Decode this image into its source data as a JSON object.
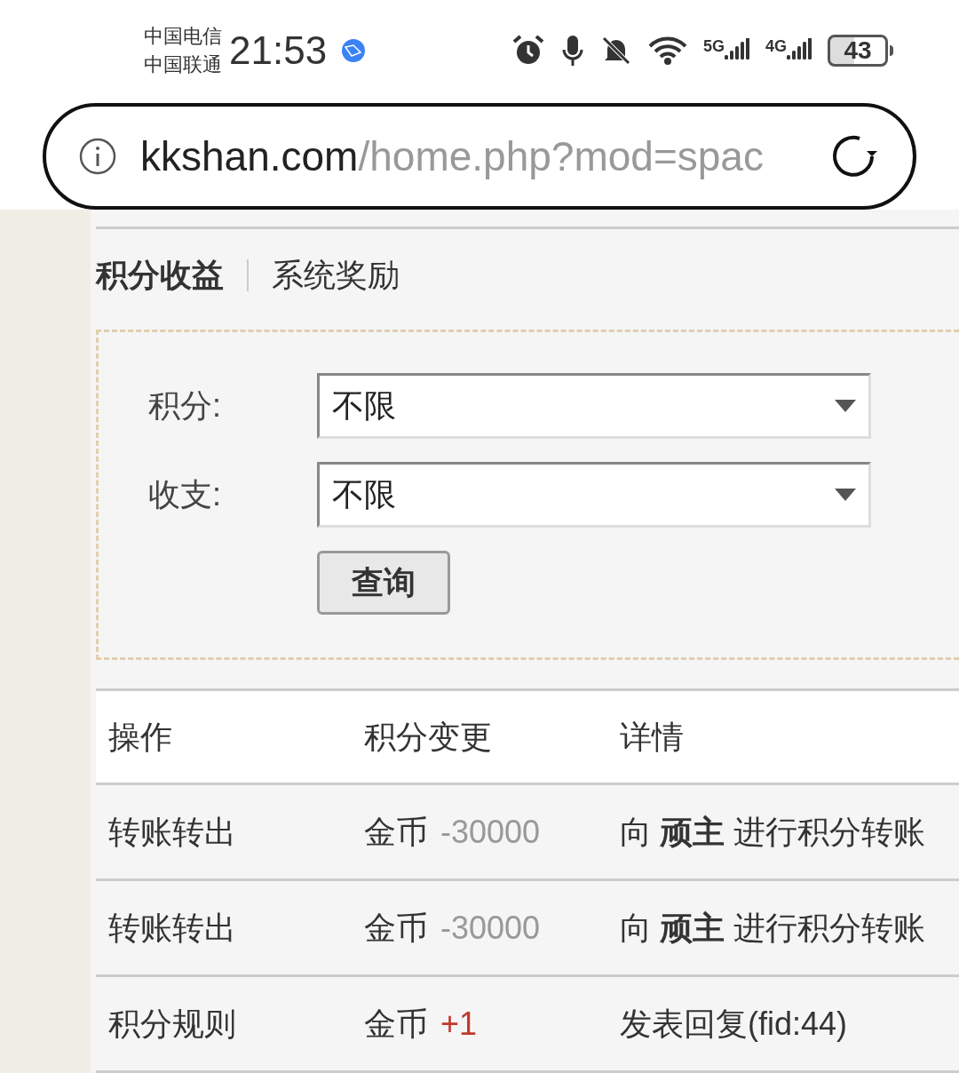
{
  "status_bar": {
    "carriers": [
      "中国电信",
      "中国联通"
    ],
    "time": "21:53",
    "battery": "43",
    "network_labels": [
      "5G",
      "4G"
    ]
  },
  "address_bar": {
    "domain": "kkshan.com",
    "path": "/home.php?mod=spac"
  },
  "tabs": [
    {
      "label": "积分收益",
      "selected": true
    },
    {
      "label": "系统奖励",
      "selected": false
    }
  ],
  "filters": [
    {
      "label": "积分:",
      "value": "不限"
    },
    {
      "label": "收支:",
      "value": "不限"
    }
  ],
  "query_button": "查询",
  "table": {
    "columns": [
      "操作",
      "积分变更",
      "详情"
    ],
    "rows": [
      {
        "action": "转账转出",
        "currency": "金币",
        "amount": "-30000",
        "color": "#999999",
        "detail": "向 **顽主** 进行积分转账"
      },
      {
        "action": "转账转出",
        "currency": "金币",
        "amount": "-30000",
        "color": "#999999",
        "detail": "向 **顽主** 进行积分转账"
      },
      {
        "action": "积分规则",
        "currency": "金币",
        "amount": "+1",
        "color": "#c0392b",
        "detail": "发表回复(fid:44)"
      }
    ]
  }
}
